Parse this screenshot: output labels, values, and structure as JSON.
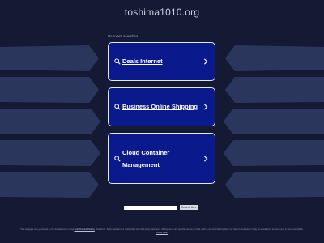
{
  "page": {
    "domain": "toshima1010.org",
    "related_label": "Relevant searches"
  },
  "colors": {
    "background": "#141a33",
    "card_fill": "#0a1a8c",
    "card_border": "#e6e9f5",
    "stripe": "#4a5a8a"
  },
  "cards": [
    {
      "label": "Deals Internet",
      "icon": "search-icon",
      "chevron": "chevron-right-icon"
    },
    {
      "label": "Business Online Shipping",
      "icon": "search-icon",
      "chevron": "chevron-right-icon"
    },
    {
      "label_line1": "Cloud Container",
      "label_line2": "Management",
      "icon": "search-icon",
      "chevron": "chevron-right-icon"
    }
  ],
  "search": {
    "input_value": "",
    "button_label": "Search Ads"
  },
  "footer": {
    "text_part1": "This webpage was generated by the domain owner using",
    "link_text": "Sedo Domain Parking",
    "text_part2": ". Disclaimer: Sedo maintains no relationship with third party advertisers. Reference to any specific service or trade mark is not controlled by Sedo nor does it constitute or imply its association, endorsement or recommendation.",
    "privacy_label": "Privacy Policy"
  }
}
